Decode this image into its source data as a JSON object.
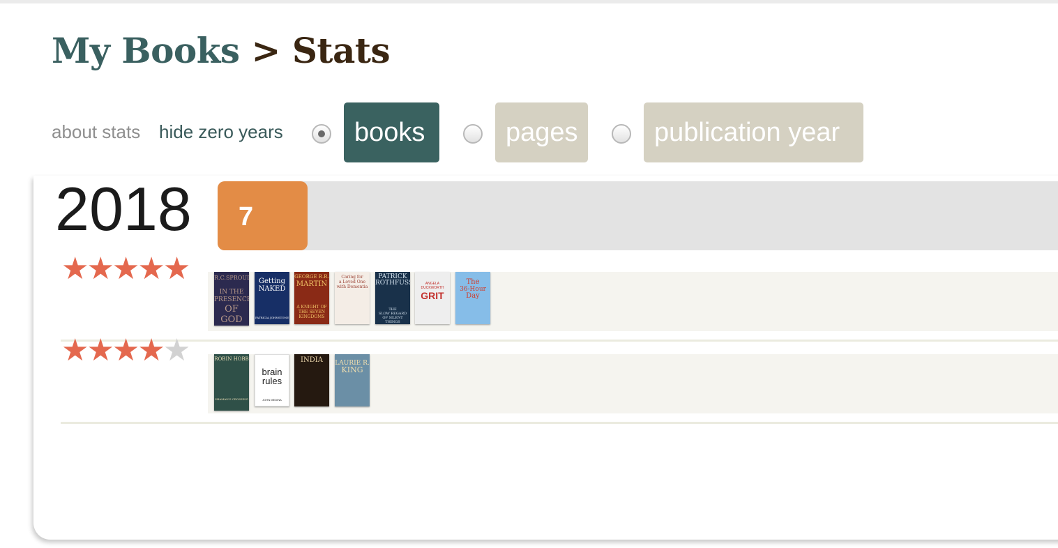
{
  "breadcrumb": {
    "parent": "My Books",
    "separator": ">",
    "current": "Stats"
  },
  "toolbar": {
    "about_stats": "about stats",
    "hide_zero_years": "hide zero years",
    "options": [
      "books",
      "pages",
      "publication year"
    ],
    "selected": "books"
  },
  "stats": {
    "year": "2018",
    "book_count": "7",
    "bar_fill_fraction": 0.107
  },
  "ratings": [
    {
      "stars": 5,
      "books": [
        {
          "title_lines": [
            "R.C.SPROUL",
            "IN THE",
            "PRESENCE",
            "OF GOD"
          ],
          "colors": [
            "#2c2a4f",
            "#b99a8a"
          ]
        },
        {
          "title_lines": [
            "Getting",
            "NAKED",
            "PATRICIA JOHNSTONE"
          ],
          "colors": [
            "#172f66",
            "#ffffff"
          ]
        },
        {
          "title_lines": [
            "GEORGE R.R.",
            "MARTIN",
            "A KNIGHT OF",
            "THE SEVEN",
            "KINGDOMS"
          ],
          "colors": [
            "#8a2a16",
            "#f0c467"
          ]
        },
        {
          "title_lines": [
            "Caring for",
            "a Loved One",
            "with Dementia"
          ],
          "colors": [
            "#f4ede6",
            "#9b4336"
          ]
        },
        {
          "title_lines": [
            "PATRICK",
            "ROTHFUSS",
            "THE",
            "SLOW REGARD",
            "OF SILENT THINGS"
          ],
          "colors": [
            "#19314a",
            "#d5e3ef"
          ]
        },
        {
          "title_lines": [
            "ANGELA",
            "DUCKWORTH",
            "GRIT"
          ],
          "colors": [
            "#eeeeee",
            "#c22f2b"
          ]
        },
        {
          "title_lines": [
            "The",
            "36-Hour",
            "Day"
          ],
          "colors": [
            "#86bde8",
            "#cf3d2c"
          ]
        }
      ]
    },
    {
      "stars": 4,
      "books": [
        {
          "title_lines": [
            "ROBIN HOBB",
            "SHAMAN'S CROSSING"
          ],
          "colors": [
            "#2f5048",
            "#e9ddb5"
          ]
        },
        {
          "title_lines": [
            "brain",
            "rules",
            "JOHN MEDINA"
          ],
          "colors": [
            "#ffffff",
            "#1b1b1b"
          ]
        },
        {
          "title_lines": [
            "INDIA"
          ],
          "colors": [
            "#251910",
            "#eed9ad"
          ]
        },
        {
          "title_lines": [
            "LAURIE R.",
            "KING"
          ],
          "colors": [
            "#6b8fa6",
            "#f2dfae"
          ]
        }
      ]
    }
  ]
}
